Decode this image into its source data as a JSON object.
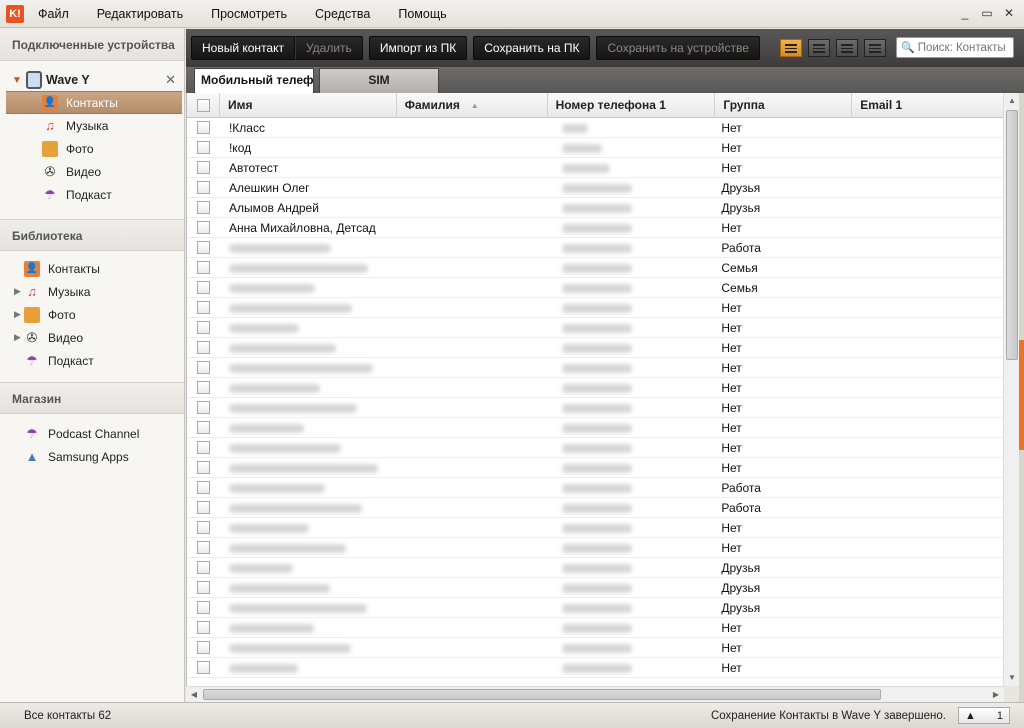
{
  "app": {
    "logo_text": "K!"
  },
  "menu": [
    "Файл",
    "Редактировать",
    "Просмотреть",
    "Средства",
    "Помощь"
  ],
  "window_controls": [
    "_",
    "▭",
    "✕"
  ],
  "sidebar": {
    "connected_title": "Подключенные устройства",
    "device_name": "Wave Y",
    "device_items": [
      {
        "label": "Контакты",
        "icon": "contacts-icon"
      },
      {
        "label": "Музыка",
        "icon": "music-icon"
      },
      {
        "label": "Фото",
        "icon": "photo-icon"
      },
      {
        "label": "Видео",
        "icon": "video-icon"
      },
      {
        "label": "Подкаст",
        "icon": "podcast-icon"
      }
    ],
    "library_title": "Библиотека",
    "library_items": [
      {
        "label": "Контакты"
      },
      {
        "label": "Музыка"
      },
      {
        "label": "Фото"
      },
      {
        "label": "Видео"
      },
      {
        "label": "Подкаст"
      }
    ],
    "store_title": "Магазин",
    "store_items": [
      {
        "label": "Podcast Channel"
      },
      {
        "label": "Samsung Apps"
      }
    ]
  },
  "toolbar": {
    "new_contact": "Новый контакт",
    "delete": "Удалить",
    "import_pc": "Импорт из ПК",
    "save_pc": "Сохранить на ПК",
    "save_device": "Сохранить на устройстве",
    "search_placeholder": "Поиск: Контакты"
  },
  "tabs": {
    "phone": "Мобильный телефон",
    "sim": "SIM"
  },
  "table": {
    "headers": [
      "Имя",
      "Фамилия",
      "Номер телефона 1",
      "Группа",
      "Email 1"
    ],
    "rows": [
      {
        "name": "!Класс",
        "group": "Нет"
      },
      {
        "name": "!код",
        "group": "Нет"
      },
      {
        "name": "Автотест",
        "group": "Нет"
      },
      {
        "name": "Алешкин Олег",
        "group": "Друзья"
      },
      {
        "name": "Алымов Андрей",
        "group": "Друзья"
      },
      {
        "name": "Анна Михайловна, Детсад",
        "group": "Нет"
      },
      {
        "name": "",
        "group": "Работа"
      },
      {
        "name": "",
        "group": "Семья"
      },
      {
        "name": "",
        "group": "Семья"
      },
      {
        "name": "",
        "group": "Нет"
      },
      {
        "name": "",
        "group": "Нет"
      },
      {
        "name": "",
        "group": "Нет"
      },
      {
        "name": "",
        "group": "Нет"
      },
      {
        "name": "",
        "group": "Нет"
      },
      {
        "name": "",
        "group": "Нет"
      },
      {
        "name": "",
        "group": "Нет"
      },
      {
        "name": "",
        "group": "Нет"
      },
      {
        "name": "",
        "group": "Нет"
      },
      {
        "name": "",
        "group": "Работа"
      },
      {
        "name": "",
        "group": "Работа"
      },
      {
        "name": "",
        "group": "Нет"
      },
      {
        "name": "",
        "group": "Нет"
      },
      {
        "name": "",
        "group": "Друзья"
      },
      {
        "name": "",
        "group": "Друзья"
      },
      {
        "name": "",
        "group": "Друзья"
      },
      {
        "name": "",
        "group": "Нет"
      },
      {
        "name": "",
        "group": "Нет"
      },
      {
        "name": "",
        "group": "Нет"
      }
    ]
  },
  "status": {
    "left": "Все контакты 62",
    "right": "Сохранение Контакты в Wave Y завершено.",
    "badge_count": "1"
  },
  "colors": {
    "accent": "#e8742a",
    "selected": "#b58d6a",
    "toolbar": "#3e3c3a"
  }
}
